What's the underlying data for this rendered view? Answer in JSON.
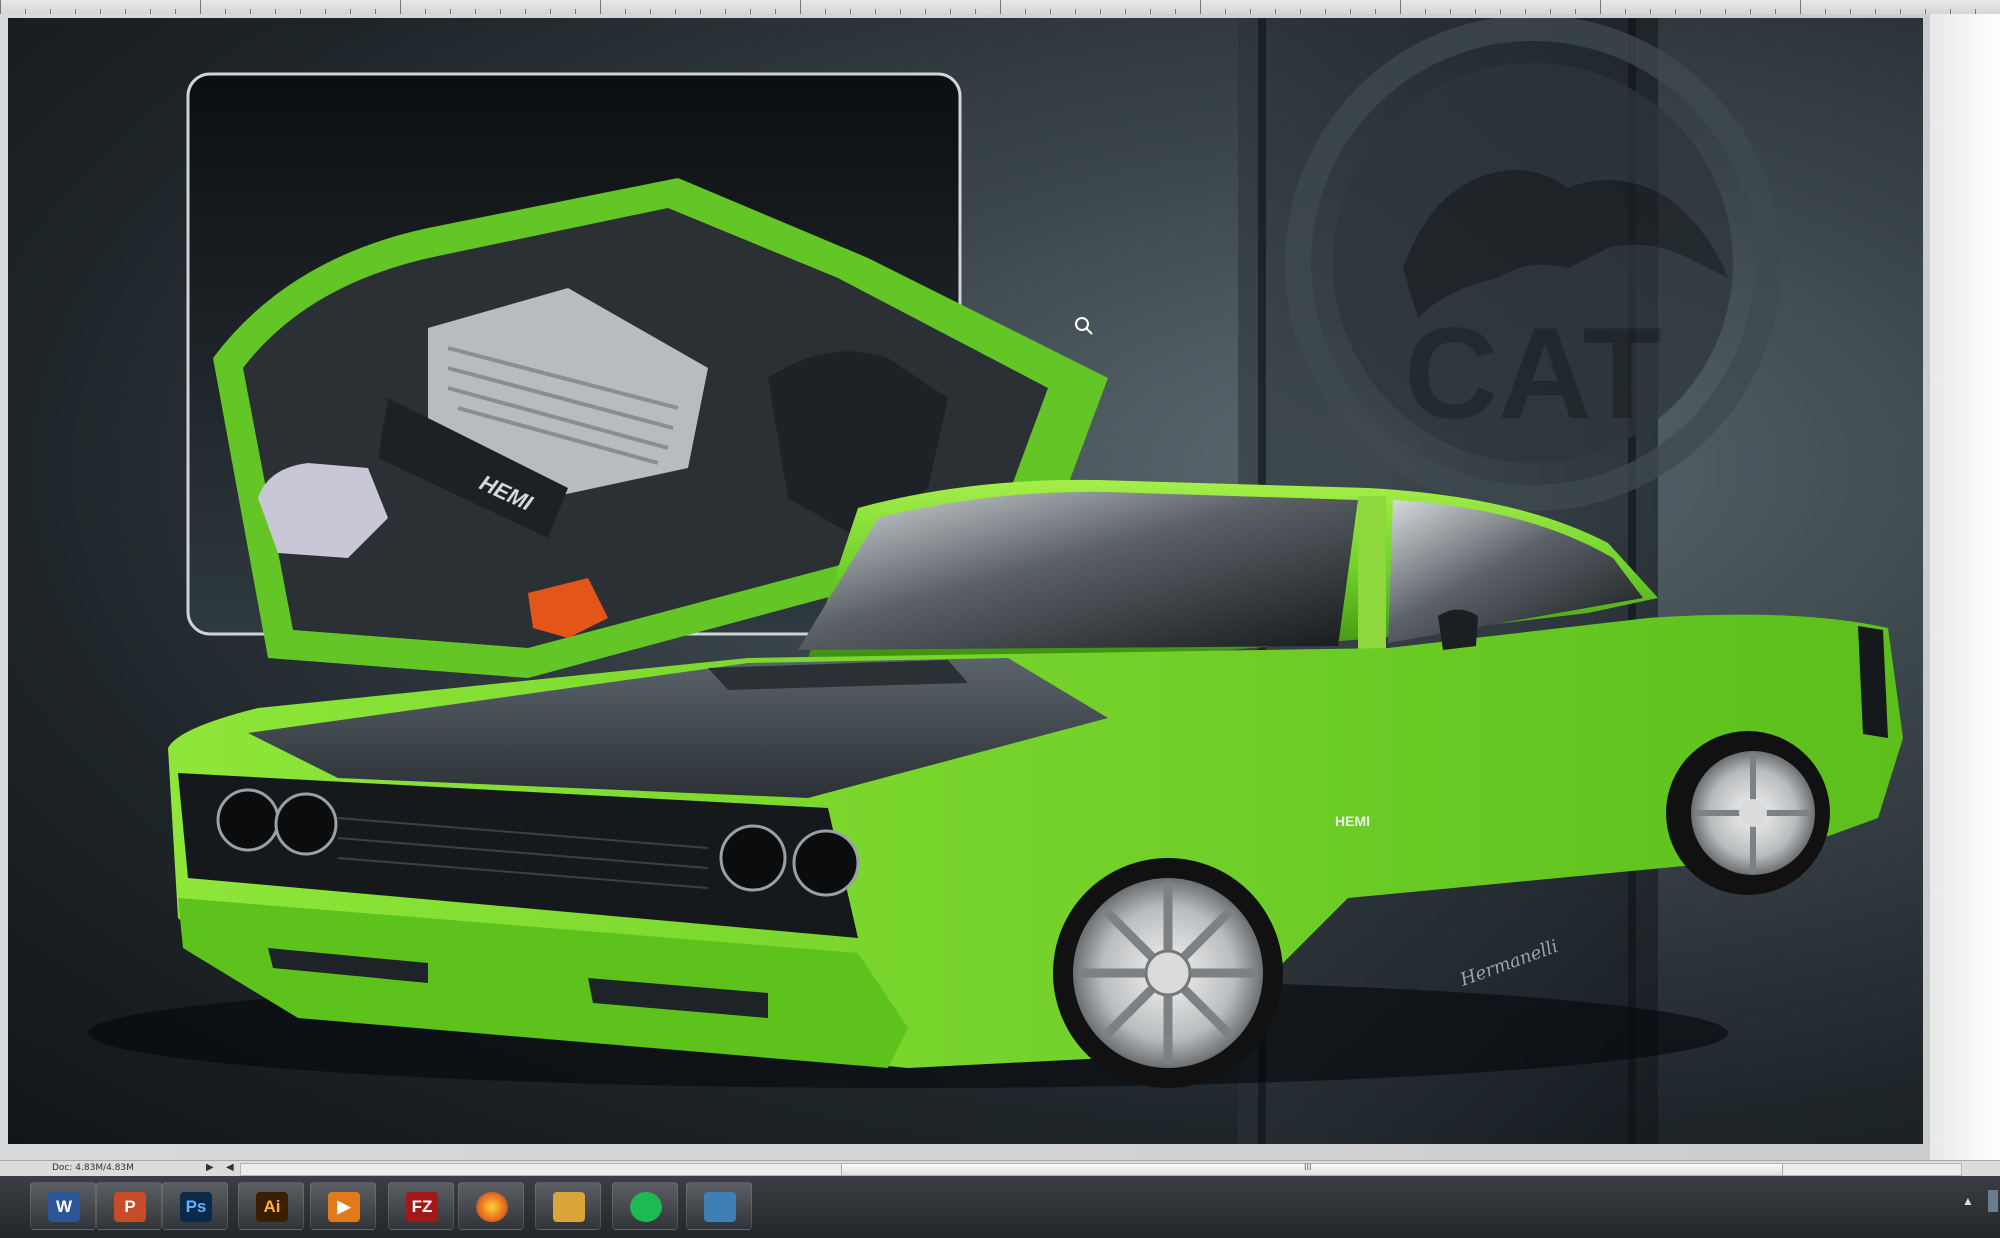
{
  "status_bar": {
    "doc_size": "Doc: 4.83M/4.83M",
    "nav_next": "▶",
    "nav_prev": "◀",
    "scroll_grip": "III"
  },
  "artwork": {
    "engine_badge": "HEMI",
    "emblem_text": "CAT",
    "fender_badge": "HEMI",
    "signature": "Hermanelli"
  },
  "taskbar": {
    "apps": [
      {
        "name": "Word",
        "icon": "word-icon",
        "label": "W",
        "color": "#2b5797"
      },
      {
        "name": "PowerPoint",
        "icon": "powerpoint-icon",
        "label": "P",
        "color": "#c84b29"
      },
      {
        "name": "Photoshop",
        "icon": "photoshop-icon",
        "label": "Ps",
        "color": "#0b2a4a"
      },
      {
        "name": "Illustrator",
        "icon": "illustrator-icon",
        "label": "Ai",
        "color": "#3a1e00"
      },
      {
        "name": "Media Player",
        "icon": "media-player-icon",
        "label": "▶",
        "color": "#e07a1a"
      },
      {
        "name": "FileZilla",
        "icon": "filezilla-icon",
        "label": "FZ",
        "color": "#a31919"
      },
      {
        "name": "Firefox",
        "icon": "firefox-icon",
        "label": "",
        "color": "#e8691c"
      },
      {
        "name": "File Explorer",
        "icon": "folder-icon",
        "label": "",
        "color": "#d9a53a"
      },
      {
        "name": "Spotify",
        "icon": "spotify-icon",
        "label": "",
        "color": "#1db954"
      },
      {
        "name": "Picture Viewer",
        "icon": "picture-viewer-icon",
        "label": "",
        "color": "#3f7fb5"
      }
    ],
    "tray_arrow": "▲"
  },
  "colors": {
    "car_green": "#6fd12a",
    "canvas_dark": "#1e2529",
    "taskbar": "#2a2d31"
  }
}
